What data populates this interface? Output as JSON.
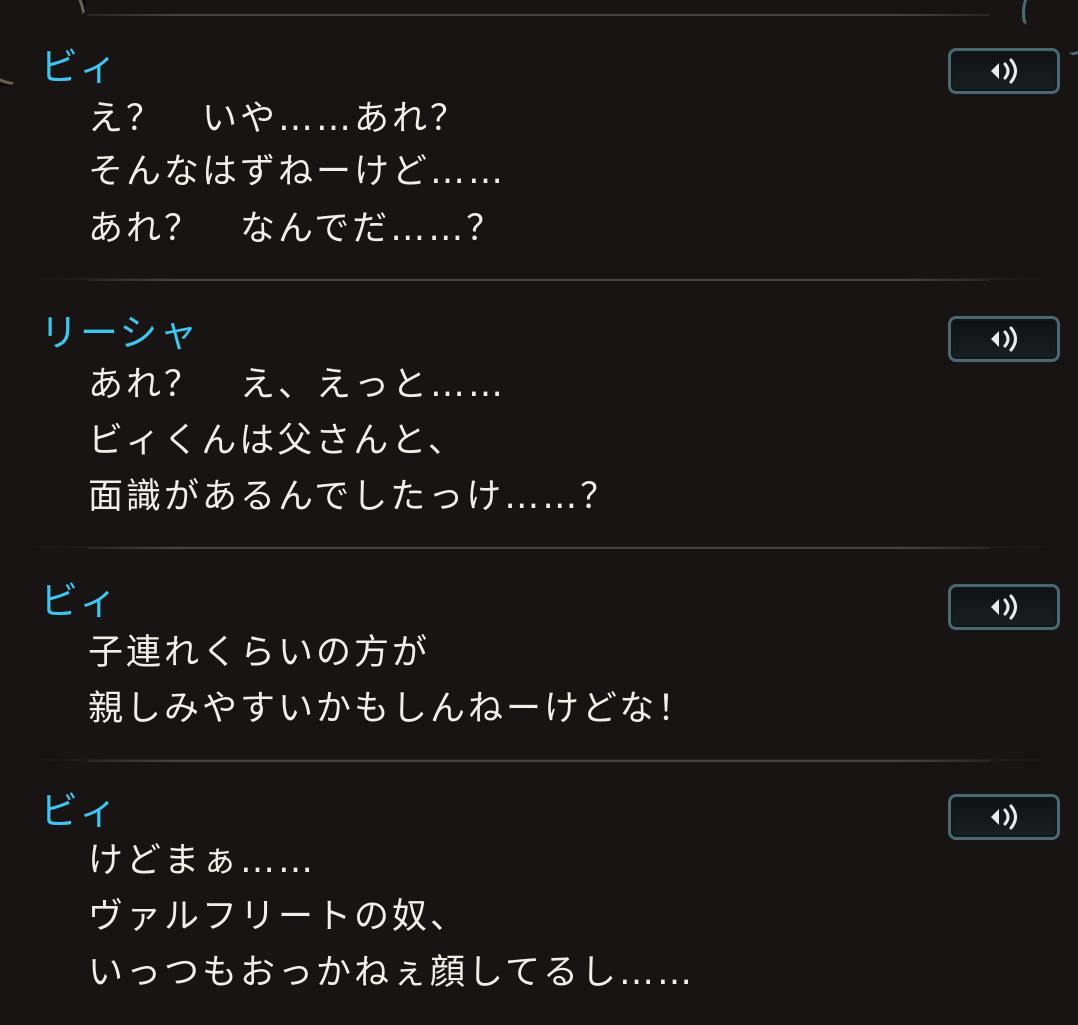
{
  "log": [
    {
      "speaker": "ビィ",
      "lines": [
        "え？　いや……あれ？",
        "そんなはずねーけど……",
        "あれ？　なんでだ……？"
      ],
      "voice_icon": "speaker-sound-icon"
    },
    {
      "speaker": "リーシャ",
      "lines": [
        "あれ？　え、えっと……",
        "ビィくんは父さんと、",
        "面識があるんでしたっけ……？"
      ],
      "voice_icon": "speaker-sound-icon"
    },
    {
      "speaker": "ビィ",
      "lines": [
        "子連れくらいの方が",
        "親しみやすいかもしんねーけどな！"
      ],
      "voice_icon": "speaker-sound-icon"
    },
    {
      "speaker": "ビィ",
      "lines": [
        "けどまぁ……",
        "ヴァルフリートの奴、",
        "いっつもおっかねぇ顔してるし……"
      ],
      "voice_icon": "speaker-sound-icon"
    }
  ],
  "colors": {
    "speaker": "#3fc6f0",
    "text": "#f2efe9",
    "background": "#181413",
    "button_border": "#4b6870"
  }
}
